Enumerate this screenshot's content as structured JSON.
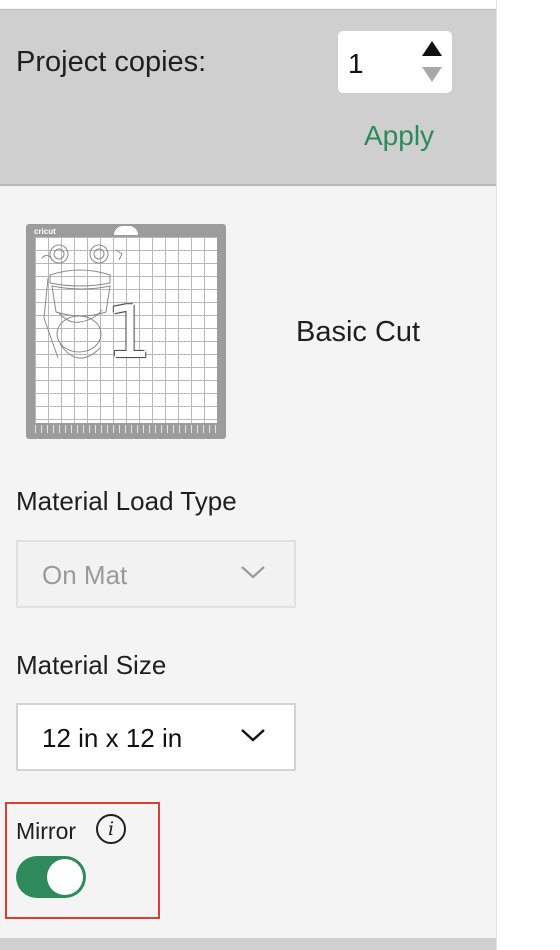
{
  "project_copies": {
    "label": "Project copies:",
    "value": "1",
    "apply_label": "Apply"
  },
  "mat": {
    "brand": "cricut",
    "number": "1",
    "cut_type": "Basic Cut"
  },
  "material_load_type": {
    "label": "Material Load Type",
    "value": "On Mat",
    "disabled": true
  },
  "material_size": {
    "label": "Material Size",
    "value": "12 in x 12 in"
  },
  "mirror": {
    "label": "Mirror",
    "info_icon": "info-icon",
    "enabled": true
  },
  "colors": {
    "accent": "#2e8a59",
    "highlight_border": "#d9402d",
    "header_bg": "#cfcfcf"
  }
}
